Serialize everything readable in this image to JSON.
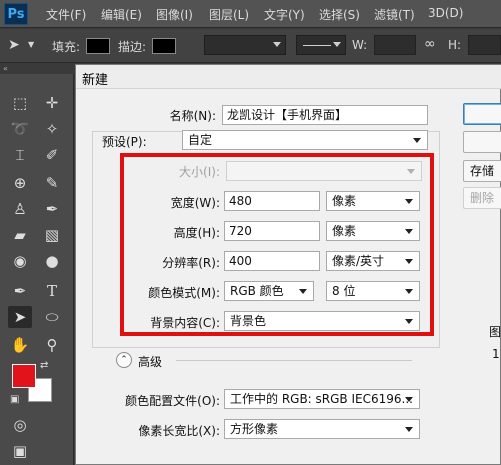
{
  "app": {
    "logo": "Ps"
  },
  "menu": {
    "items": [
      "文件(F)",
      "编辑(E)",
      "图像(I)",
      "图层(L)",
      "文字(Y)",
      "选择(S)",
      "滤镜(T)",
      "3D(D)"
    ]
  },
  "options_bar": {
    "fill_label": "填充:",
    "stroke_label": "描边:",
    "w_label": "W:",
    "h_label": "H:"
  },
  "dialog": {
    "title": "新建",
    "name_label": "名称(N):",
    "name_value": "龙凯设计【手机界面】",
    "preset_label": "预设(P):",
    "preset_value": "自定",
    "size_label": "大小(I):",
    "size_value": "",
    "width_label": "宽度(W):",
    "width_value": "480",
    "width_unit": "像素",
    "height_label": "高度(H):",
    "height_value": "720",
    "height_unit": "像素",
    "resolution_label": "分辨率(R):",
    "resolution_value": "400",
    "resolution_unit": "像素/英寸",
    "color_mode_label": "颜色模式(M):",
    "color_mode_value": "RGB 颜色",
    "bit_depth_value": "8 位",
    "background_label": "背景内容(C):",
    "background_value": "背景色",
    "advanced_label": "高级",
    "color_profile_label": "颜色配置文件(O):",
    "color_profile_value": "工作中的 RGB: sRGB IEC6196...",
    "pixel_aspect_label": "像素长宽比(X):",
    "pixel_aspect_value": "方形像素",
    "buttons": {
      "ok": "",
      "cancel": "",
      "save_preset": "存储",
      "delete_preset": "删除"
    },
    "side_info": {
      "image_size_label": "图",
      "image_size_value": "1"
    }
  },
  "colors": {
    "foreground": "#e3131b",
    "background": "#ffffff",
    "highlight": "#e01010"
  }
}
